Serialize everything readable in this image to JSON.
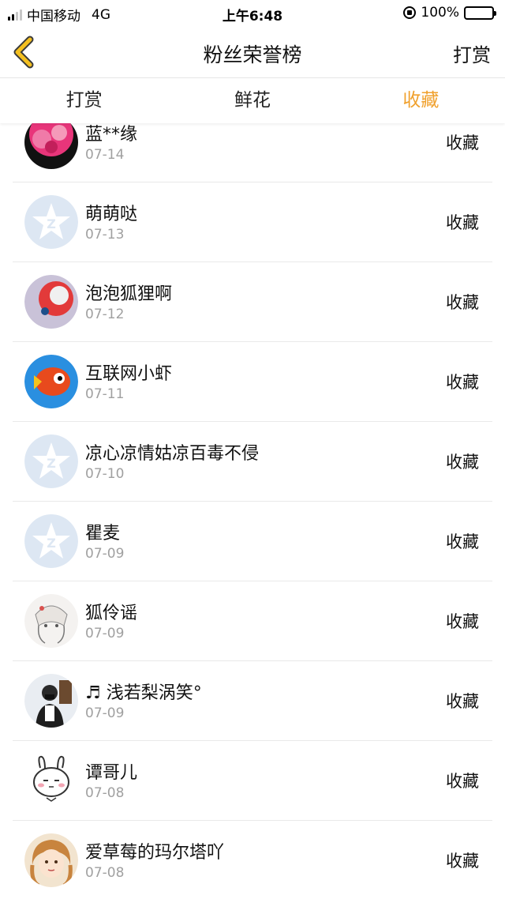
{
  "status_bar": {
    "carrier": "中国移动",
    "network": "4G",
    "time": "上午6:48",
    "battery_percent": "100%",
    "battery_color": "#4cd964"
  },
  "nav": {
    "back_icon": "chevron-left-icon",
    "title": "粉丝荣誉榜",
    "right_label": "打赏"
  },
  "tabs": [
    {
      "label": "打赏",
      "active": false
    },
    {
      "label": "鲜花",
      "active": false
    },
    {
      "label": "收藏",
      "active": true
    }
  ],
  "accent_color": "#f0a02c",
  "list": [
    {
      "name": "蓝**缘",
      "date": "07-14",
      "action": "收藏",
      "avatar": "pink-flower-avatar"
    },
    {
      "name": "萌萌哒",
      "date": "07-13",
      "action": "收藏",
      "avatar": "default-qq-avatar"
    },
    {
      "name": "泡泡狐狸啊",
      "date": "07-12",
      "action": "收藏",
      "avatar": "red-fox-avatar"
    },
    {
      "name": "互联网小虾",
      "date": "07-11",
      "action": "收藏",
      "avatar": "cartoon-fish-avatar"
    },
    {
      "name": "凉心凉情姑凉百毒不侵",
      "date": "07-10",
      "action": "收藏",
      "avatar": "default-qq-avatar"
    },
    {
      "name": "瞿麦",
      "date": "07-09",
      "action": "收藏",
      "avatar": "default-qq-avatar"
    },
    {
      "name": "狐伶谣",
      "date": "07-09",
      "action": "收藏",
      "avatar": "anime-girl-sketch-avatar"
    },
    {
      "name": "♬ 浅若梨涡笑°",
      "date": "07-09",
      "action": "收藏",
      "avatar": "man-photo-avatar"
    },
    {
      "name": "谭哥儿",
      "date": "07-08",
      "action": "收藏",
      "avatar": "rabbit-avatar"
    },
    {
      "name": "爱草莓的玛尔塔吖",
      "date": "07-08",
      "action": "收藏",
      "avatar": "anime-girl-color-avatar"
    }
  ]
}
